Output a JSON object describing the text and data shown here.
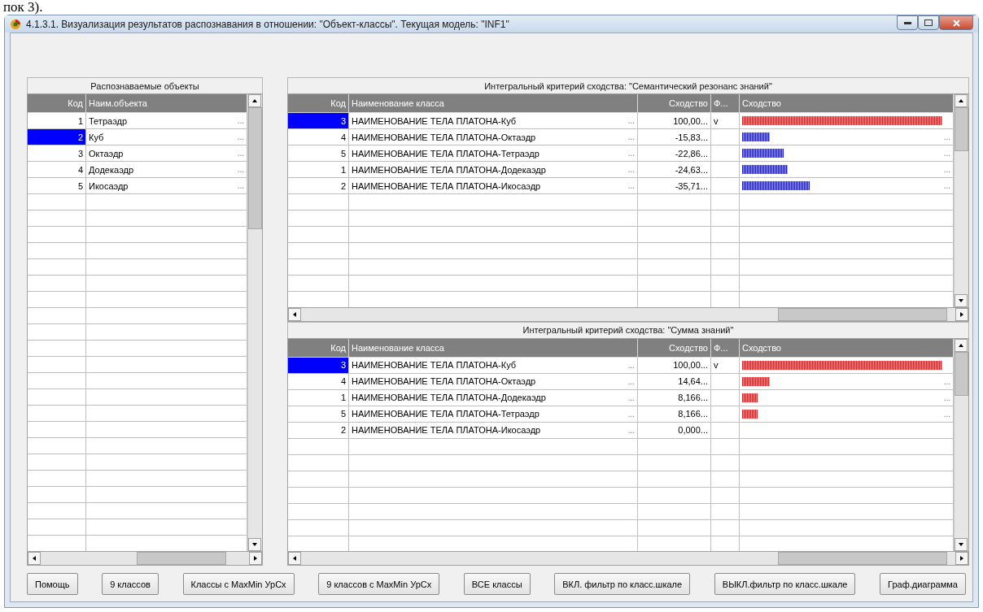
{
  "background_text": "пок 3).",
  "window": {
    "title": "4.1.3.1. Визуализация результатов распознавания в отношении: \"Объект-классы\". Текущая модель: \"INF1\""
  },
  "objects_panel": {
    "title": "Распознаваемые объекты",
    "columns": [
      "Код",
      "Наим.объекта"
    ],
    "rows": [
      {
        "code": "1",
        "name": "Тетраэдр",
        "dots": "...",
        "selected": false
      },
      {
        "code": "2",
        "name": "Куб",
        "dots": "...",
        "selected": true
      },
      {
        "code": "3",
        "name": "Октаэдр",
        "dots": "...",
        "selected": false
      },
      {
        "code": "4",
        "name": "Додекаэдр",
        "dots": "...",
        "selected": false
      },
      {
        "code": "5",
        "name": "Икосаэдр",
        "dots": "...",
        "selected": false
      }
    ]
  },
  "similarity_panels": [
    {
      "title": "Интегральный критерий сходства: \"Семантический резонанс знаний\"",
      "columns": [
        "Код",
        "Наименование класса",
        "Сходство",
        "Ф...",
        "Сходство"
      ],
      "rows": [
        {
          "code": "3",
          "name": "НАИМЕНОВАНИЕ ТЕЛА ПЛАТОНА-Куб",
          "dots": "...",
          "value": "100,00...",
          "flag": "v",
          "level": 0.96,
          "color": "#d02828",
          "selected": true
        },
        {
          "code": "4",
          "name": "НАИМЕНОВАНИЕ ТЕЛА ПЛАТОНА-Октаэдр",
          "dots": "...",
          "value": "-15,83...",
          "level": 0.14,
          "color": "#2020c0",
          "bar_dots": "...",
          "selected": false
        },
        {
          "code": "5",
          "name": "НАИМЕНОВАНИЕ ТЕЛА ПЛАТОНА-Тетраэдр",
          "dots": "...",
          "value": "-22,86...",
          "level": 0.21,
          "color": "#2020c0",
          "bar_dots": "...",
          "selected": false
        },
        {
          "code": "1",
          "name": "НАИМЕНОВАНИЕ ТЕЛА ПЛАТОНА-Додекаэдр",
          "dots": "...",
          "value": "-24,63...",
          "level": 0.23,
          "color": "#2020c0",
          "bar_dots": "...",
          "selected": false
        },
        {
          "code": "2",
          "name": "НАИМЕНОВАНИЕ ТЕЛА ПЛАТОНА-Икосаэдр",
          "dots": "...",
          "value": "-35,71...",
          "level": 0.34,
          "color": "#2020c0",
          "bar_dots": "...",
          "selected": false
        }
      ]
    },
    {
      "title": "Интегральный критерий сходства: \"Сумма знаний\"",
      "columns": [
        "Код",
        "Наименование класса",
        "Сходство",
        "Ф...",
        "Сходство"
      ],
      "rows": [
        {
          "code": "3",
          "name": "НАИМЕНОВАНИЕ ТЕЛА ПЛАТОНА-Куб",
          "dots": "...",
          "value": "100,00...",
          "flag": "v",
          "level": 0.96,
          "color": "#d02828",
          "selected": true
        },
        {
          "code": "4",
          "name": "НАИМЕНОВАНИЕ ТЕЛА ПЛАТОНА-Октаэдр",
          "dots": "...",
          "value": "14,64...",
          "level": 0.14,
          "color": "#d02828",
          "bar_dots": "...",
          "selected": false
        },
        {
          "code": "1",
          "name": "НАИМЕНОВАНИЕ ТЕЛА ПЛАТОНА-Додекаэдр",
          "dots": "...",
          "value": "8,166...",
          "level": 0.08,
          "color": "#d02828",
          "bar_dots": "...",
          "selected": false
        },
        {
          "code": "5",
          "name": "НАИМЕНОВАНИЕ ТЕЛА ПЛАТОНА-Тетраэдр",
          "dots": "...",
          "value": "8,166...",
          "level": 0.08,
          "color": "#d02828",
          "bar_dots": "...",
          "selected": false
        },
        {
          "code": "2",
          "name": "НАИМЕНОВАНИЕ ТЕЛА ПЛАТОНА-Икосаэдр",
          "dots": "...",
          "value": "0,000...",
          "selected": false
        }
      ]
    }
  ],
  "buttons": [
    "Помощь",
    "9 классов",
    "Классы с MaxMin УрСх",
    "9 классов с MaxMin УрСх",
    "ВСЕ классы",
    "ВКЛ. фильтр по класс.шкале",
    "ВЫКЛ.фильтр по класс.шкале",
    "Граф.диаграмма"
  ]
}
